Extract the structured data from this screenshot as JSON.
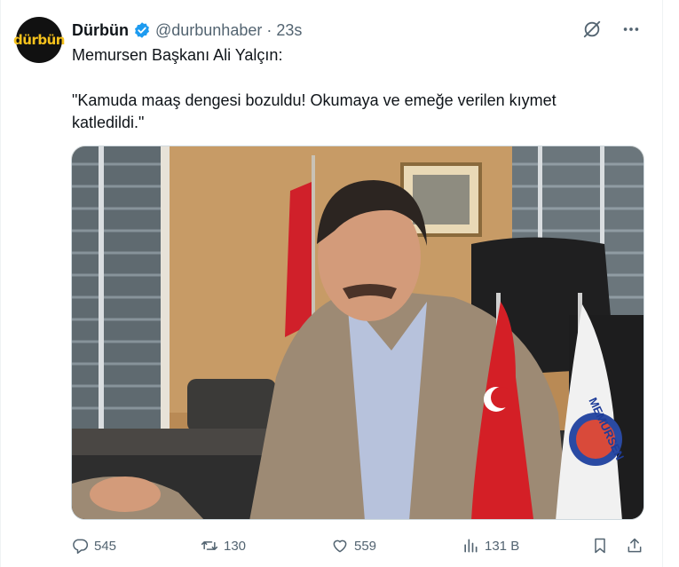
{
  "account": {
    "avatar_text": "dürbün",
    "display_name": "Dürbün",
    "handle": "@durbunhaber",
    "separator": "·",
    "time": "23s"
  },
  "tweet": {
    "line1": "Memursen Başkanı Ali Yalçın:",
    "line2": "\"Kamuda maaş dengesi bozuldu! Okumaya ve emeğe verilen kıymet katledildi.\""
  },
  "media": {
    "flag_text": "MEMURSEN"
  },
  "actions": {
    "replies": "545",
    "retweets": "130",
    "likes": "559",
    "views": "131 B"
  },
  "colors": {
    "accent": "#1d9bf0",
    "secondary_text": "#536471",
    "avatar_bg": "#111111",
    "avatar_text": "#f6c21c"
  },
  "icons": [
    "verified-badge-icon",
    "grok-icon",
    "more-icon",
    "reply-icon",
    "retweet-icon",
    "like-icon",
    "views-icon",
    "bookmark-icon",
    "share-icon"
  ]
}
